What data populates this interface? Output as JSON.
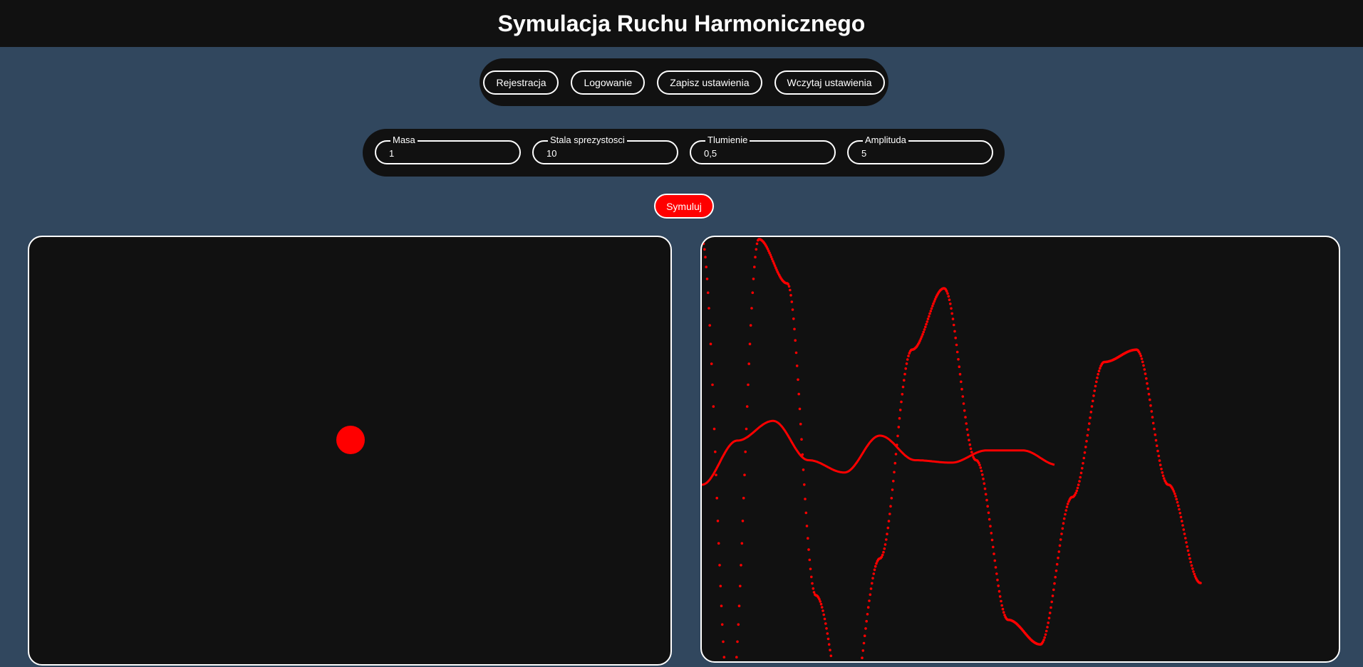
{
  "header": {
    "title": "Symulacja Ruchu Harmonicznego"
  },
  "nav": {
    "register": "Rejestracja",
    "login": "Logowanie",
    "save_settings": "Zapisz ustawienia",
    "load_settings": "Wczytaj ustawienia"
  },
  "params": {
    "mass": {
      "label": "Masa",
      "value": "1"
    },
    "spring_constant": {
      "label": "Stala sprezystosci",
      "value": "10"
    },
    "damping": {
      "label": "Tlumienie",
      "value": "0,5"
    },
    "amplitude": {
      "label": "Amplituda",
      "value": "5"
    }
  },
  "simulate_label": "Symuluj",
  "colors": {
    "accent": "#ff0000",
    "panel": "#111111",
    "background": "#31475e"
  },
  "chart_data": {
    "type": "line",
    "title": "",
    "xlabel": "",
    "ylabel": "",
    "grid": false,
    "series": [
      {
        "style": "dotted",
        "x": [
          0,
          0.08,
          0.16,
          0.24,
          0.32,
          0.41,
          0.5,
          0.59,
          0.68,
          0.77,
          0.86,
          0.95,
          1.04,
          1.13,
          1.22,
          1.31,
          1.4
        ],
        "y": [
          1.0,
          -0.92,
          1.0,
          0.82,
          -0.45,
          -0.99,
          -0.3,
          0.55,
          0.8,
          0.1,
          -0.55,
          -0.65,
          -0.05,
          0.5,
          0.55,
          0.0,
          -0.4
        ]
      },
      {
        "style": "solid",
        "x": [
          0,
          0.1,
          0.2,
          0.3,
          0.4,
          0.5,
          0.6,
          0.7,
          0.8,
          0.9,
          1.0,
          1.1,
          1.2,
          1.3,
          1.4
        ],
        "y": [
          0.0,
          0.18,
          0.26,
          0.1,
          0.05,
          0.2,
          0.1,
          0.09,
          0.14,
          0.14,
          0.08,
          0.11,
          0.06,
          0.11,
          0.1
        ]
      }
    ]
  }
}
